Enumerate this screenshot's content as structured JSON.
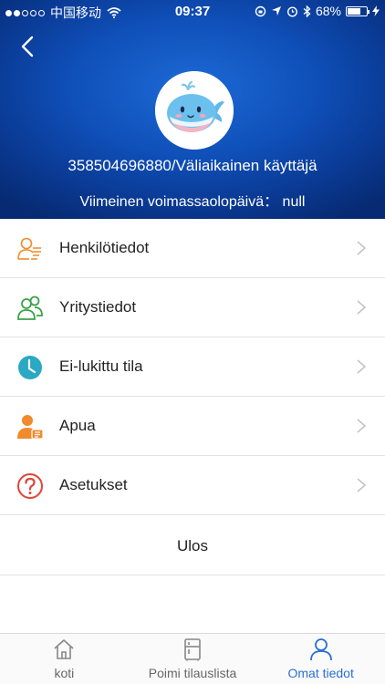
{
  "status_bar": {
    "carrier": "中国移动",
    "time": "09:37",
    "battery_text": "68%",
    "battery_level": 0.68
  },
  "profile": {
    "username": "358504696880/Väliaikainen käyttäjä",
    "expiry": "Viimeinen voimassaolopäivä： null"
  },
  "menu": {
    "items": [
      {
        "label": "Henkilötiedot",
        "icon": "person-info-icon",
        "color": "#f08a2c"
      },
      {
        "label": "Yritystiedot",
        "icon": "people-icon",
        "color": "#3aa24a"
      },
      {
        "label": "Ei-lukittu tila",
        "icon": "clock-icon",
        "color": "#2aa8c4"
      },
      {
        "label": "Apua",
        "icon": "help-person-icon",
        "color": "#f08a2c"
      },
      {
        "label": "Asetukset",
        "icon": "question-icon",
        "color": "#e0443a"
      }
    ],
    "logout": "Ulos"
  },
  "tabbar": {
    "tabs": [
      {
        "label": "koti",
        "icon": "home-icon"
      },
      {
        "label": "Poimi tilauslista",
        "icon": "fridge-icon"
      },
      {
        "label": "Omat tiedot",
        "icon": "user-icon",
        "active": true
      }
    ],
    "active_color": "#2a6fd6"
  }
}
